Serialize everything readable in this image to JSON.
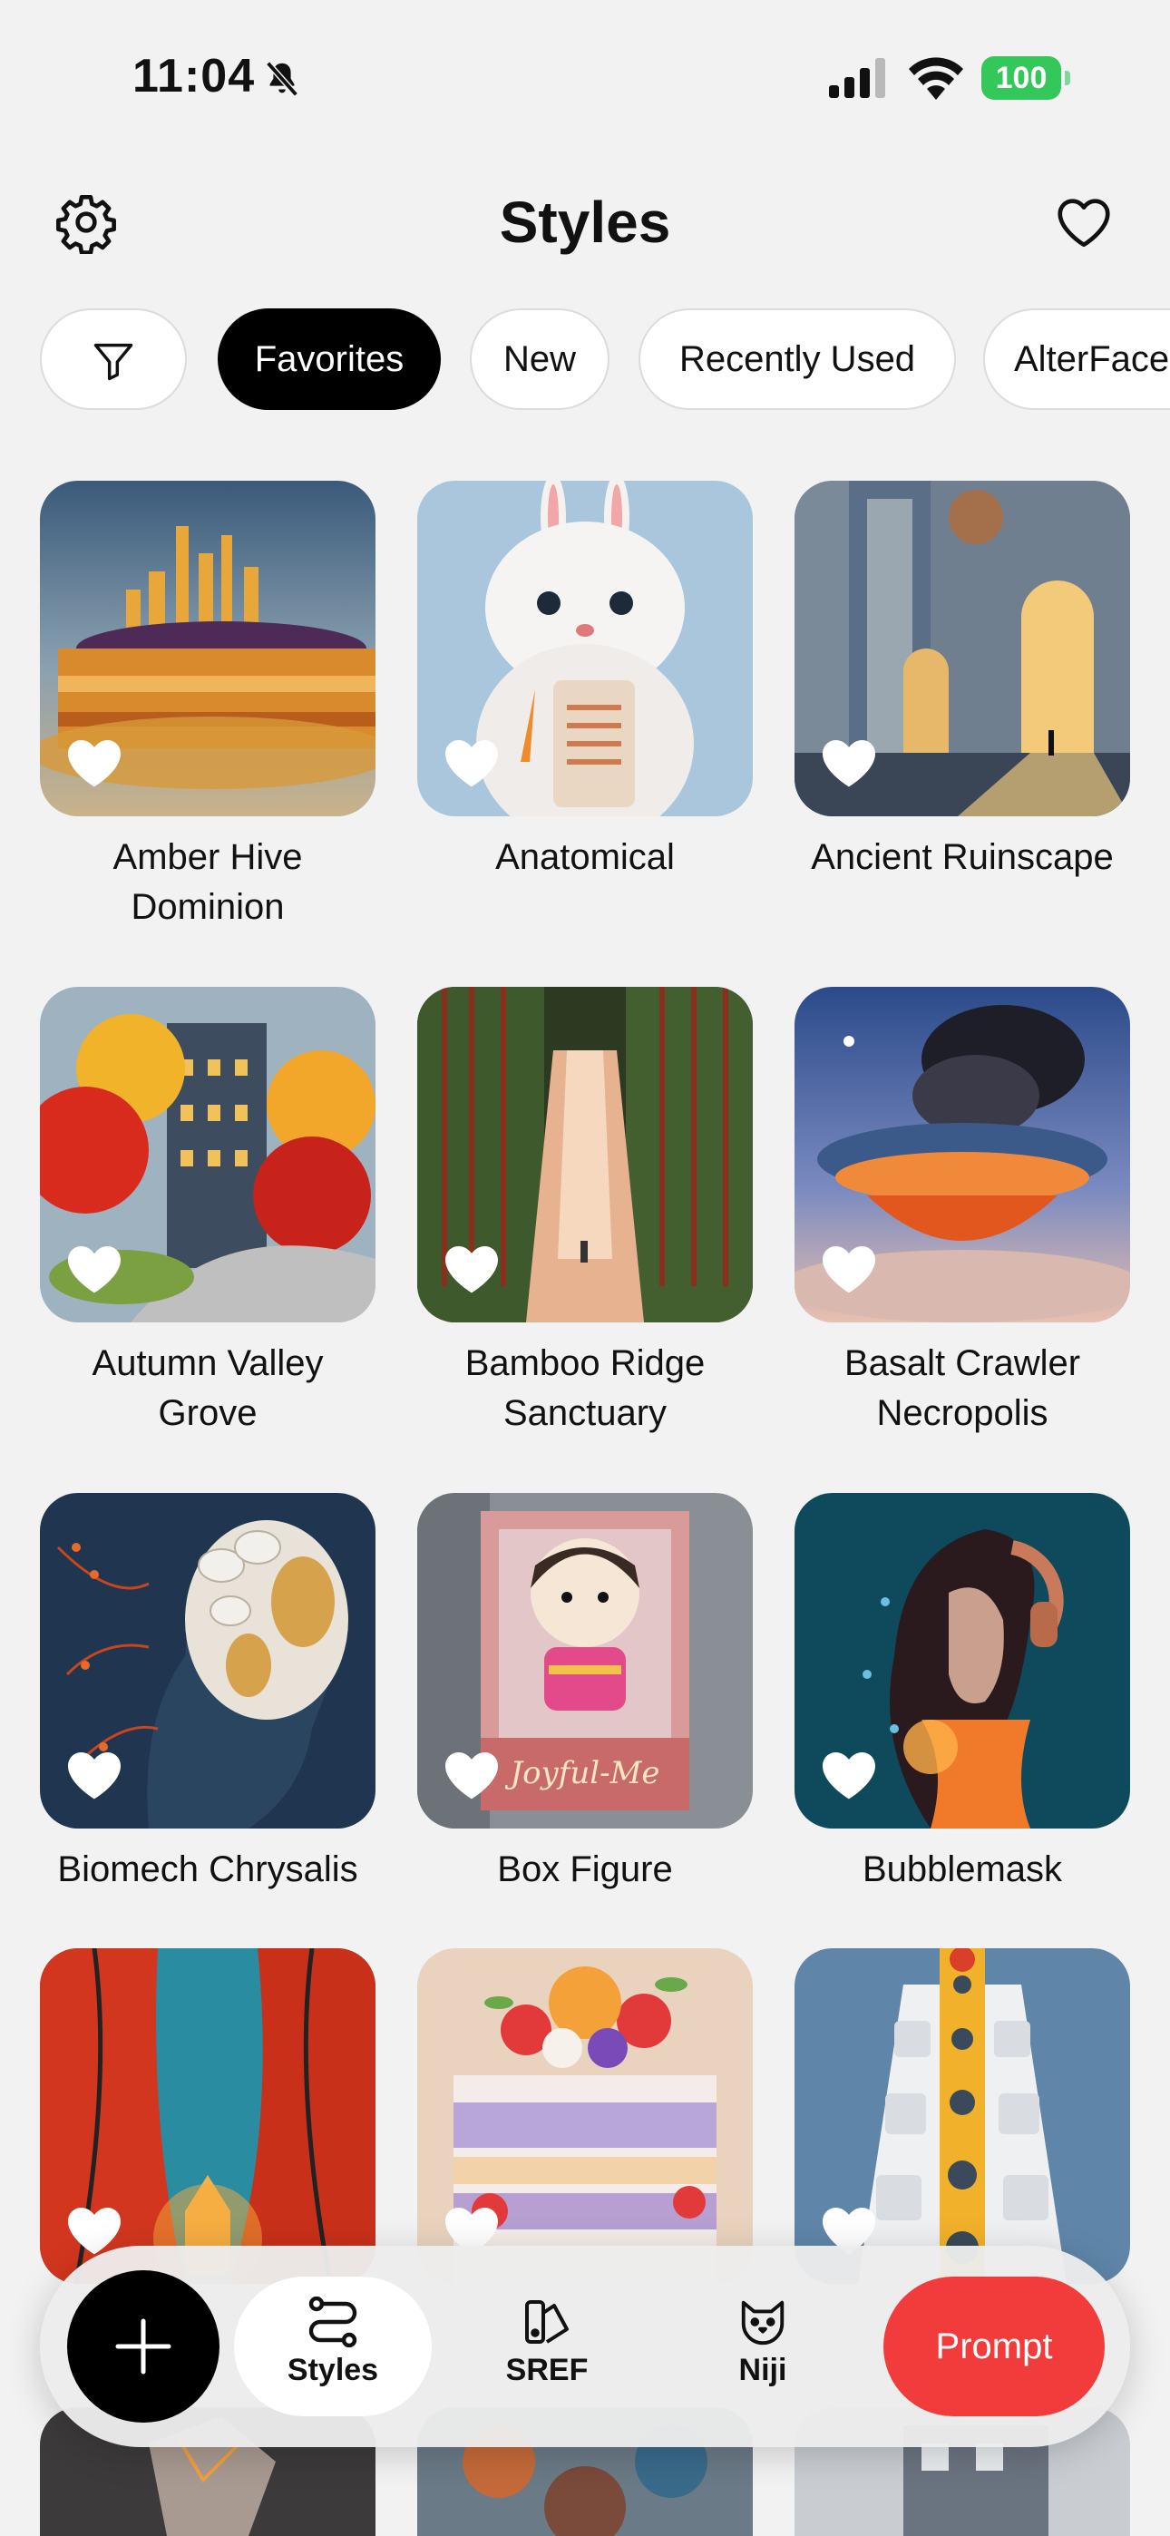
{
  "status_bar": {
    "time": "11:04",
    "battery": "100",
    "icons": [
      "bell-slash-icon",
      "cellular-signal-icon",
      "wifi-icon",
      "battery-icon"
    ],
    "battery_color": "#34c759"
  },
  "header": {
    "title": "Styles",
    "icons": [
      "gear-icon",
      "heart-outline-icon"
    ]
  },
  "filters": {
    "chips": [
      {
        "label": "Favorites",
        "active": true
      },
      {
        "label": "New",
        "active": false
      },
      {
        "label": "Recently Used",
        "active": false
      },
      {
        "label": "AlterFace",
        "active": false
      }
    ]
  },
  "styles": [
    {
      "name": "Amber Hive Dominion",
      "favorited": true
    },
    {
      "name": "Anatomical",
      "favorited": true
    },
    {
      "name": "Ancient Ruinscape",
      "favorited": true
    },
    {
      "name": "Autumn Valley Grove",
      "favorited": true
    },
    {
      "name": "Bamboo Ridge Sanctuary",
      "favorited": true
    },
    {
      "name": "Basalt Crawler Necropolis",
      "favorited": true
    },
    {
      "name": "Biomech Chrysalis",
      "favorited": true
    },
    {
      "name": "Box Figure",
      "favorited": true
    },
    {
      "name": "Bubblemask",
      "favorited": true
    },
    {
      "name": "",
      "favorited": true
    },
    {
      "name": "",
      "favorited": true
    },
    {
      "name": "",
      "favorited": true
    }
  ],
  "bottom_nav": {
    "tabs": [
      {
        "label": "Styles",
        "icon": "styles-icon",
        "active": true
      },
      {
        "label": "SREF",
        "icon": "sref-icon",
        "active": false
      },
      {
        "label": "Niji",
        "icon": "cat-icon",
        "active": false
      }
    ],
    "prompt_label": "Prompt",
    "prompt_color": "#f23b3b"
  }
}
